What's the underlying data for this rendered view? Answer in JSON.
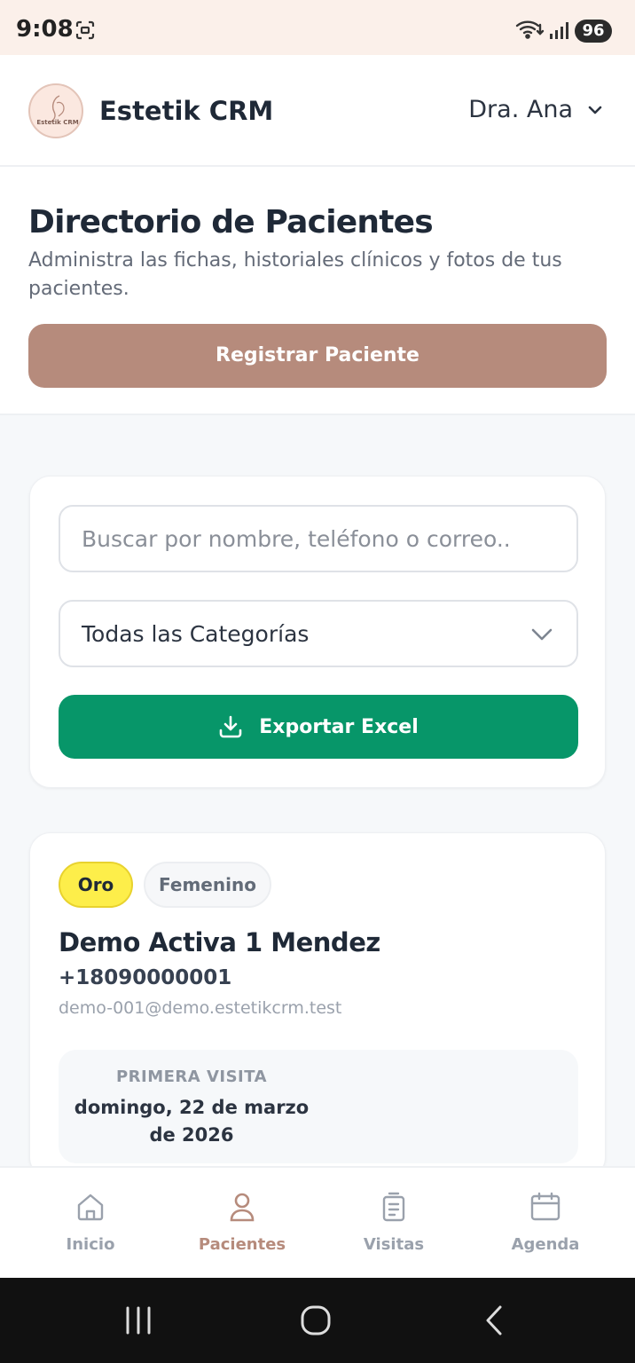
{
  "status": {
    "time": "9:08",
    "battery": "96"
  },
  "header": {
    "app_title": "Estetik CRM",
    "logo_text": "Estetik CRM",
    "user_name": "Dra. Ana"
  },
  "intro": {
    "title": "Directorio de Pacientes",
    "subtitle": "Administra las fichas, historiales clínicos y fotos de tus pacientes.",
    "register_label": "Registrar Paciente"
  },
  "filters": {
    "search_placeholder": "Buscar por nombre, teléfono o correo..",
    "search_value": "",
    "category_selected": "Todas las Categorías",
    "export_label": "Exportar Excel"
  },
  "patients": [
    {
      "tier": "Oro",
      "gender": "Femenino",
      "name": "Demo Activa 1 Mendez",
      "phone": "+18090000001",
      "email": "demo-001@demo.estetikcrm.test",
      "first_visit_label": "PRIMERA VISITA",
      "first_visit_date": "domingo, 22 de marzo de 2026"
    }
  ],
  "bottom_nav": [
    {
      "label": "Inicio",
      "icon": "home-icon",
      "active": false
    },
    {
      "label": "Pacientes",
      "icon": "user-icon",
      "active": true
    },
    {
      "label": "Visitas",
      "icon": "clipboard-icon",
      "active": false
    },
    {
      "label": "Agenda",
      "icon": "calendar-icon",
      "active": false
    }
  ],
  "colors": {
    "brand": "#b68b7c",
    "export_green": "#079669",
    "tier_gold": "#fdee4a",
    "text_dark": "#1f2937"
  }
}
